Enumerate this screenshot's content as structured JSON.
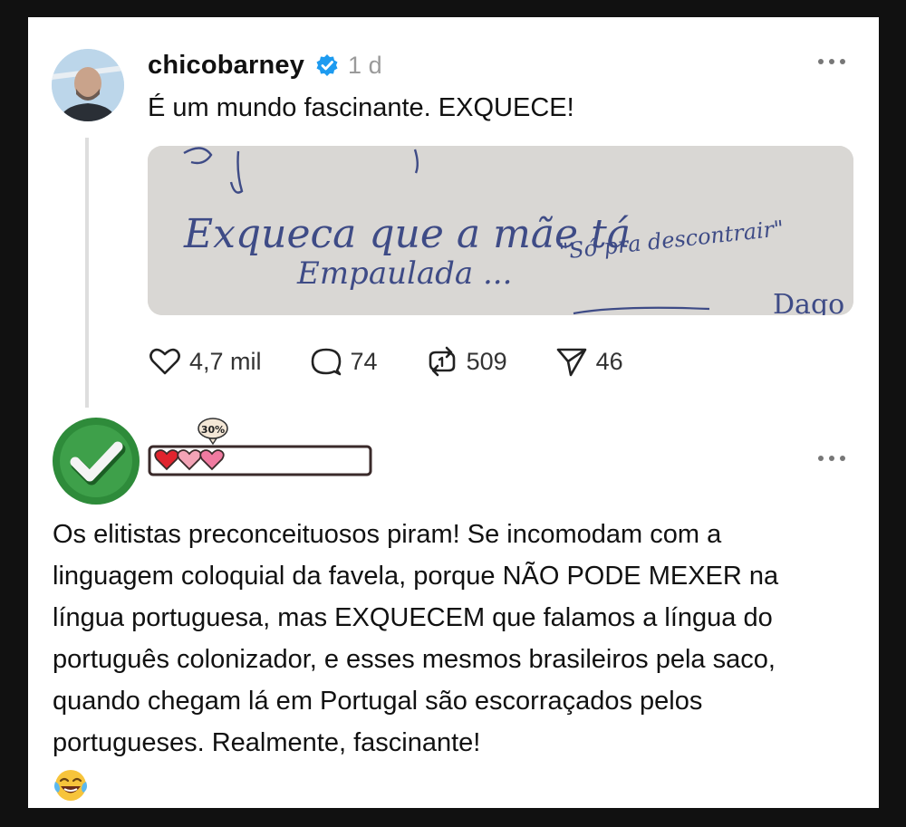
{
  "post": {
    "username": "chicobarney",
    "time": "1 d",
    "text": "É um mundo fascinante. EXQUECE!",
    "image": {
      "handwriting_line1": "Exqueca que a mãe tá",
      "handwriting_line2": "Empaulada ...",
      "handwriting_quote": "\"Só pra descontrair\""
    },
    "actions": {
      "likes": "4,7 mil",
      "comments": "74",
      "reposts": "509",
      "shares": "46"
    }
  },
  "reply": {
    "badge_percent": "30%",
    "hearts_filled": 1,
    "hearts_total": 3,
    "text": "Os elitistas preconceituosos piram! Se incomodam com a linguagem coloquial da favela, porque NÃO PODE MEXER na língua portuguesa, mas EXQUECEM que falamos a língua do português colonizador, e esses mesmos brasileiros pela saco, quando chegam lá em Portugal são escorraçados pelos portugueses. Realmente, fascinante!"
  },
  "colors": {
    "verified": "#1d9bf0",
    "checkmark_green": "#2e8b3a",
    "heart_red": "#e0242e",
    "heart_pink": "#f3a3b6"
  }
}
